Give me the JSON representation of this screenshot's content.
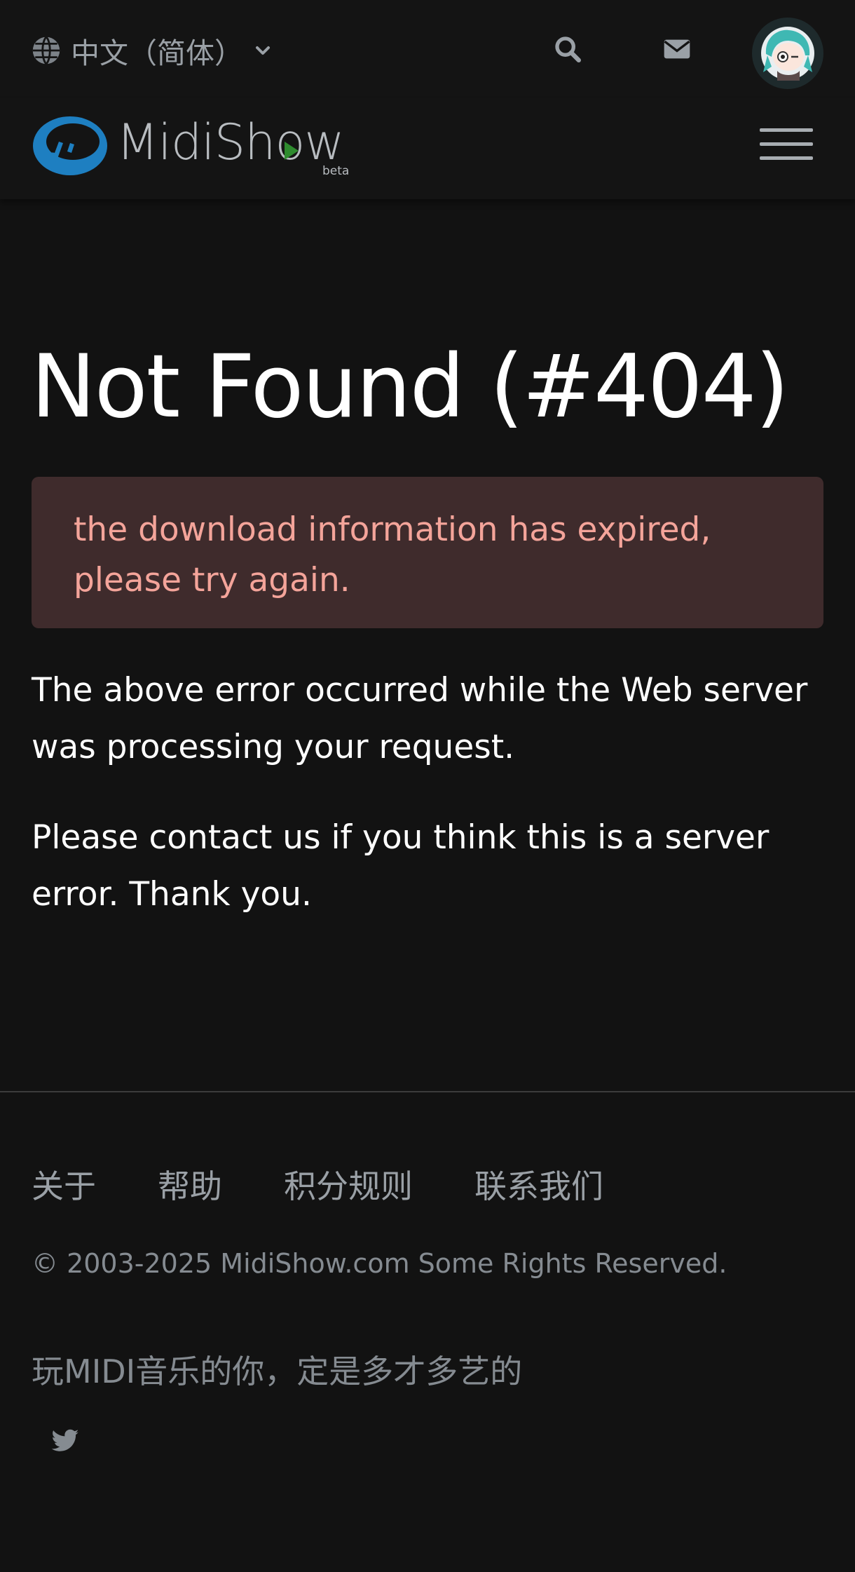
{
  "header": {
    "language": "中文（简体）",
    "logo_text": "MidiShow",
    "logo_badge": "beta"
  },
  "error": {
    "title": "Not Found (#404)",
    "message": "the download information has expired, please try again.",
    "paragraph_1": "The above error occurred while the Web server was processing your request.",
    "paragraph_2": "Please contact us if you think this is a server error. Thank you."
  },
  "footer": {
    "links": [
      "关于",
      "帮助",
      "积分规则",
      "联系我们"
    ],
    "copyright": "© 2003-2025 MidiShow.com Some Rights Reserved.",
    "slogan": "玩MIDI音乐的你，定是多才多艺的"
  },
  "icons": {
    "language": "globe-icon",
    "search": "search-icon",
    "mail": "envelope-icon",
    "menu": "hamburger-icon",
    "social": "twitter-icon"
  },
  "colors": {
    "background": "#121212",
    "brand_blue": "#1e7fc1",
    "alert_bg": "#3f2b2c",
    "alert_text": "#f4a49a"
  }
}
